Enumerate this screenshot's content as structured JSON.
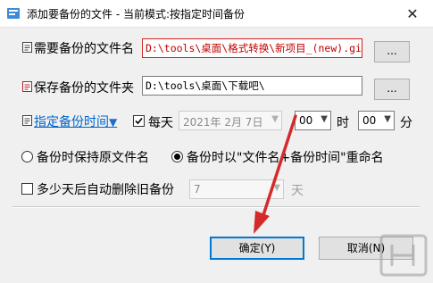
{
  "window": {
    "title": "添加要备份的文件 - 当前模式:按指定时间备份",
    "close_glyph": "✕"
  },
  "source": {
    "label": "需要备份的文件名",
    "value": "D:\\tools\\桌面\\格式转换\\新项目_(new).gif",
    "browse_label": "..."
  },
  "destination": {
    "label": "保存备份的文件夹",
    "value": "D:\\tools\\桌面\\下载吧\\",
    "browse_label": "..."
  },
  "schedule": {
    "link_label": "指定备份时间",
    "link_arrow": "▼",
    "daily_label": "每天",
    "daily_checked": true,
    "date_value": "2021年 2月 7日",
    "hour_value": "00",
    "hour_unit": "时",
    "minute_value": "00",
    "minute_unit": "分"
  },
  "naming": {
    "option_keep_label": "备份时保持原文件名",
    "option_rename_label": "备份时以\"文件名+备份时间\"重命名",
    "selected": "rename"
  },
  "cleanup": {
    "label": "多少天后自动删除旧备份",
    "checked": false,
    "days_value": "7",
    "days_unit": "天"
  },
  "footer": {
    "ok_label": "确定(Y)",
    "cancel_label": "取消(N)"
  },
  "colors": {
    "accent": "#0078d7",
    "link": "#0066cc",
    "error": "#d32020",
    "annotation_arrow": "#d42a2a"
  }
}
